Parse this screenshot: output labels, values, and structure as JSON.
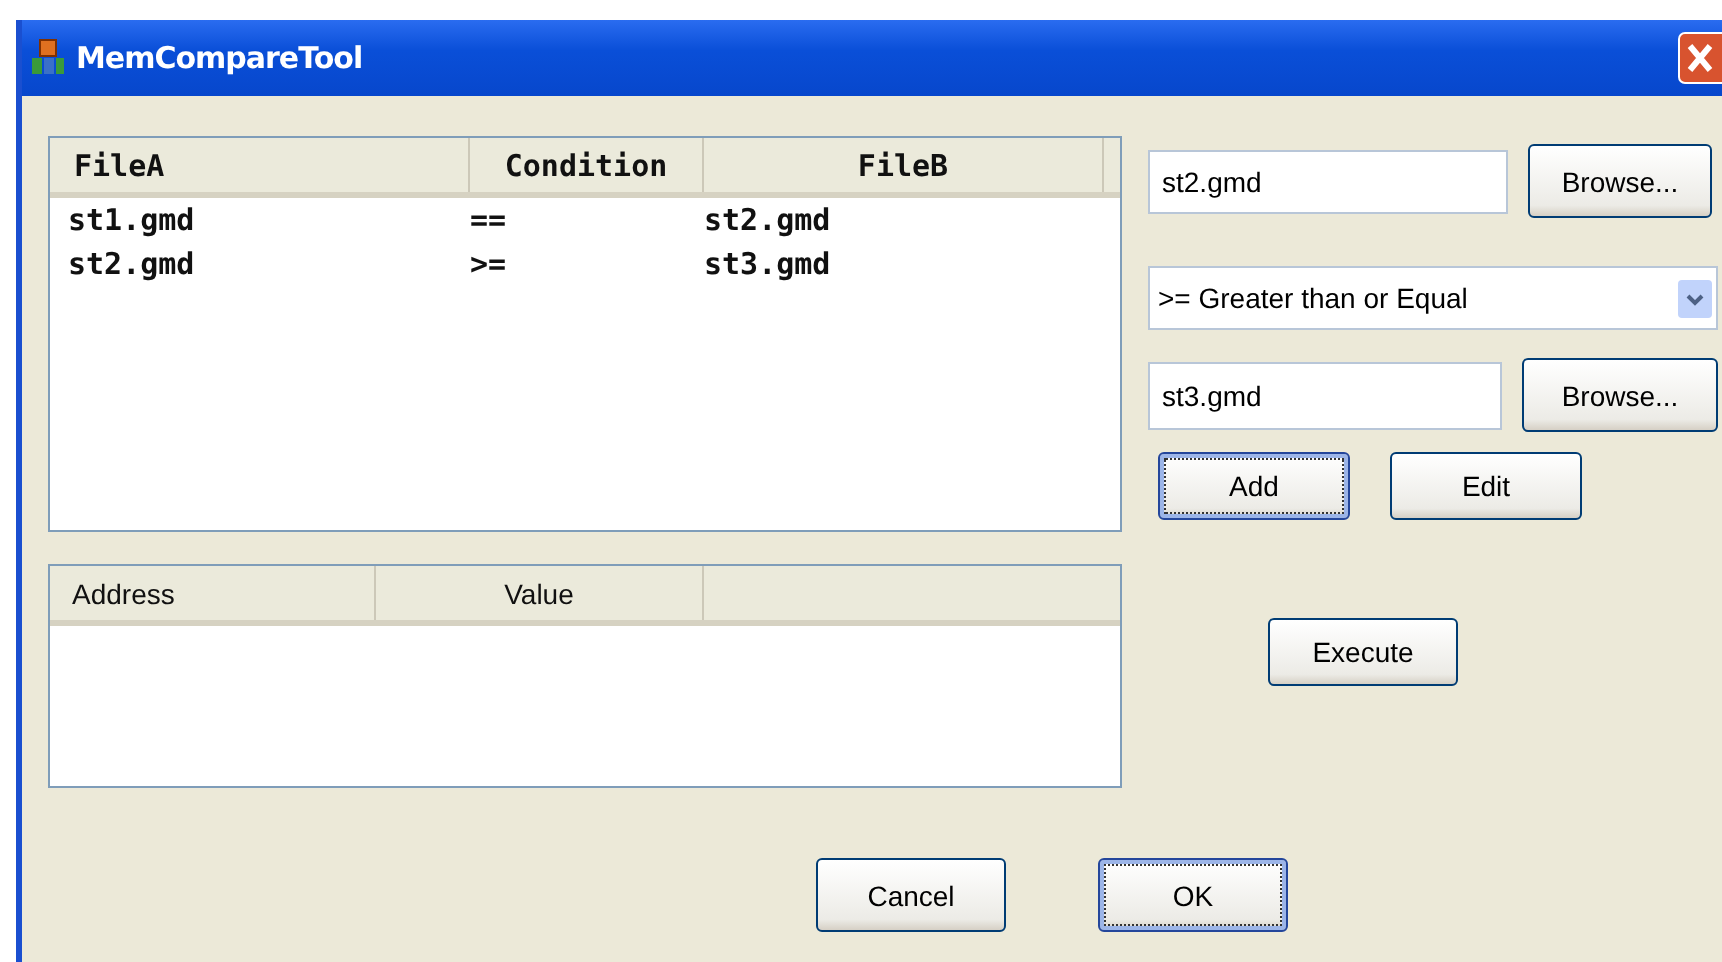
{
  "window": {
    "title": "MemCompareTool"
  },
  "comparison_list": {
    "columns": [
      "FileA",
      "Condition",
      "FileB"
    ],
    "rows": [
      {
        "cells": [
          "st1.gmd",
          "==",
          "st2.gmd"
        ]
      },
      {
        "cells": [
          "st2.gmd",
          ">=",
          "st3.gmd"
        ]
      }
    ]
  },
  "file_a": {
    "value": "st2.gmd",
    "browse_button": "Browse..."
  },
  "condition": {
    "value": ">= Greater than or Equal"
  },
  "file_b": {
    "value": "st3.gmd",
    "browse_button": "Browse..."
  },
  "edit_buttons": [
    {
      "label": "Add",
      "focused": true
    },
    {
      "label": "Edit",
      "focused": false
    }
  ],
  "result_list": {
    "columns": [
      "Address",
      "Value"
    ]
  },
  "execute_button": {
    "label": "Execute",
    "focused": false
  },
  "dialog_buttons": [
    {
      "label": "Cancel",
      "focused": false
    },
    {
      "label": "OK",
      "focused": true
    }
  ]
}
